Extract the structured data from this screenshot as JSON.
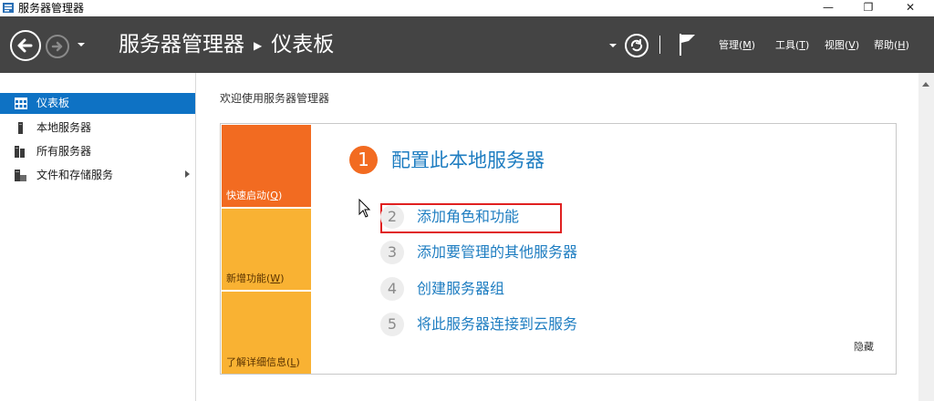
{
  "window": {
    "title": "服务器管理器",
    "controls": {
      "minimize": "—",
      "restore": "❐",
      "close": "✕"
    }
  },
  "navbar": {
    "breadcrumb": {
      "root": "服务器管理器",
      "current": "仪表板"
    },
    "menus": [
      {
        "label": "管理",
        "key": "M"
      },
      {
        "label": "工具",
        "key": "T"
      },
      {
        "label": "视图",
        "key": "V"
      },
      {
        "label": "帮助",
        "key": "H"
      }
    ],
    "icons": [
      "back-arrow-icon",
      "forward-arrow-icon",
      "chevron-down-icon",
      "refresh-icon",
      "flag-icon"
    ]
  },
  "sidebar": {
    "items": [
      {
        "label": "仪表板",
        "icon": "dashboard-icon",
        "active": true
      },
      {
        "label": "本地服务器",
        "icon": "server-icon"
      },
      {
        "label": "所有服务器",
        "icon": "servers-icon"
      },
      {
        "label": "文件和存储服务",
        "icon": "file-storage-icon",
        "expandable": true
      }
    ]
  },
  "main": {
    "welcome": "欢迎使用服务器管理器",
    "tiles": [
      {
        "label": "快速启动",
        "key": "Q",
        "color": "#f26b21"
      },
      {
        "label": "新增功能",
        "key": "W",
        "color": "#f9b233"
      },
      {
        "label": "了解详细信息",
        "key": "L",
        "color": "#f9b233"
      }
    ],
    "step1": {
      "number": "1",
      "title": "配置此本地服务器"
    },
    "steps": [
      {
        "number": "2",
        "label": "添加角色和功能"
      },
      {
        "number": "3",
        "label": "添加要管理的其他服务器"
      },
      {
        "number": "4",
        "label": "创建服务器组"
      },
      {
        "number": "5",
        "label": "将此服务器连接到云服务"
      }
    ],
    "hide": "隐藏"
  },
  "colors": {
    "navbar_bg": "#444444",
    "accent_blue": "#1e7dc1",
    "sidebar_active": "#0e72c4",
    "orange": "#f26b21",
    "amber": "#f9b233",
    "highlight_red": "#e02020"
  }
}
